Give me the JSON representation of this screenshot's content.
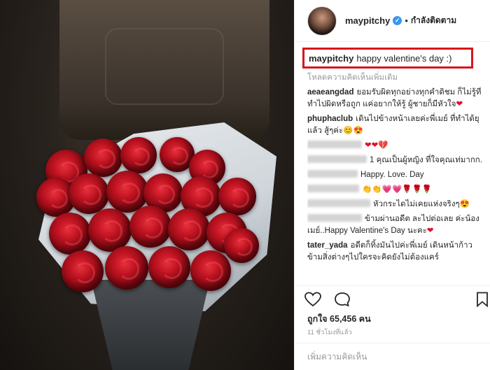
{
  "header": {
    "username": "maypitchy",
    "following_label": "กำลังติดตาม"
  },
  "caption": {
    "username": "maypitchy",
    "text": "happy valentine's day :)"
  },
  "load_more_label": "โหลดความคิดเห็นเพิ่มเติม",
  "comments": [
    {
      "username": "aeaeangdad",
      "text": "ยอมรับผิดทุกอย่างทุกคำติชม ก็ไม่รู้ที่ทำไปผิดหรือถูก แค่อยากให้รู้ ผู้ชายก็มีหัวใจ",
      "emoji": "❤"
    },
    {
      "username": "phuphaclub",
      "text": "เดินไปข้างหน้าเลยค่ะพี่เมย์ ที่ทำได้ยุแล้ว สู้ๆค่ะ",
      "emoji": "😊😍"
    },
    {
      "username": "",
      "text": "",
      "emoji": "❤❤💔"
    },
    {
      "username": "",
      "text": "1 คุณเป็นผู้หญิง ที่ใจคุณเท่มากก.",
      "emoji": ""
    },
    {
      "username": "",
      "text": "Happy. Love. Day",
      "emoji": ""
    },
    {
      "username": "",
      "text": "",
      "emoji": "👏👏💗💗🌹🌹🌹"
    },
    {
      "username": "",
      "text": "หัวกระไดไม่เคยแห่งจริงๆ",
      "emoji": "😍"
    },
    {
      "username": "",
      "text": "ข้ามผ่านอดีต ละไปต่อเลย ค่ะน้องเมย์..Happy Valentine's Day นะคะ",
      "emoji": "❤"
    },
    {
      "username": "tater_yada",
      "text": "อดีตก็ทิ้งมันไปค่ะพี่เมย์ เดินหน้าก้าวข้ามสิ่งต่างๆไปใครจะคิดยังไม่ต้องแคร์",
      "emoji": ""
    }
  ],
  "likes_label": "ถูกใจ 65,456 คน",
  "time_label": "11 ชั่วโมงที่แล้ว",
  "add_comment_placeholder": "เพิ่มความคิดเห็น",
  "colors": {
    "highlight_box": "#d8161b",
    "link_blue": "#3897f0",
    "heart_red": "#e0102a"
  },
  "icons": [
    "verified-badge-icon",
    "heart-icon",
    "comment-icon",
    "bookmark-icon"
  ]
}
